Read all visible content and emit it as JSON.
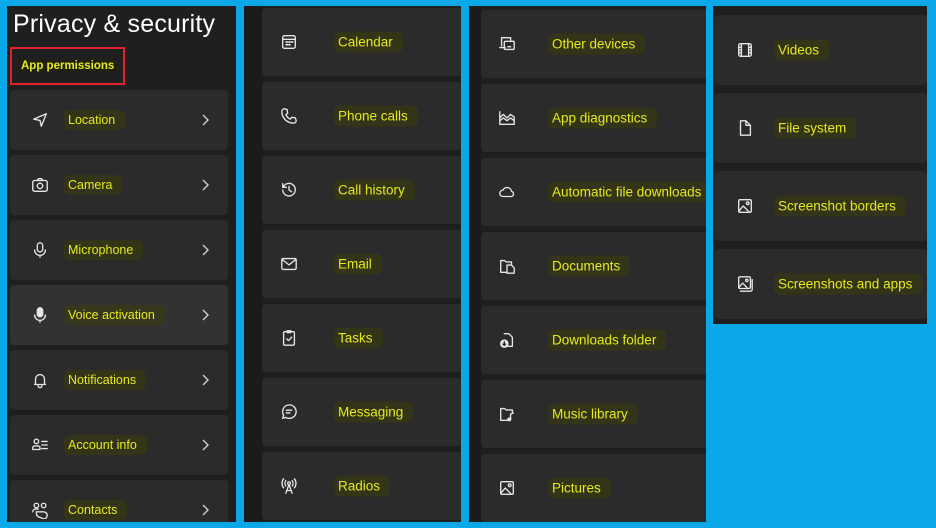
{
  "header": {
    "title": "Privacy & security",
    "section_label": "App permissions"
  },
  "colors": {
    "background": "#0aa8e6",
    "panel": "#1f1f1f",
    "card": "#2b2b2b",
    "highlight_text": "#e4ea1c",
    "section_box_border": "#e5202e"
  },
  "panels": [
    {
      "items": [
        {
          "label": "Location",
          "icon": "location-icon",
          "chevron": true
        },
        {
          "label": "Camera",
          "icon": "camera-icon",
          "chevron": true
        },
        {
          "label": "Microphone",
          "icon": "microphone-icon",
          "chevron": true
        },
        {
          "label": "Voice activation",
          "icon": "voice-activation-icon",
          "chevron": true
        },
        {
          "label": "Notifications",
          "icon": "bell-icon",
          "chevron": true
        },
        {
          "label": "Account info",
          "icon": "account-info-icon",
          "chevron": true
        },
        {
          "label": "Contacts",
          "icon": "contacts-icon",
          "chevron": true
        }
      ]
    },
    {
      "items": [
        {
          "label": "Calendar",
          "icon": "calendar-icon"
        },
        {
          "label": "Phone calls",
          "icon": "phone-icon"
        },
        {
          "label": "Call history",
          "icon": "history-icon"
        },
        {
          "label": "Email",
          "icon": "email-icon"
        },
        {
          "label": "Tasks",
          "icon": "tasks-icon"
        },
        {
          "label": "Messaging",
          "icon": "messaging-icon"
        },
        {
          "label": "Radios",
          "icon": "radio-tower-icon"
        }
      ]
    },
    {
      "items": [
        {
          "label": "Other devices",
          "icon": "other-devices-icon"
        },
        {
          "label": "App diagnostics",
          "icon": "app-diagnostics-icon"
        },
        {
          "label": "Automatic file downloads",
          "icon": "cloud-icon"
        },
        {
          "label": "Documents",
          "icon": "documents-icon"
        },
        {
          "label": "Downloads folder",
          "icon": "downloads-folder-icon"
        },
        {
          "label": "Music library",
          "icon": "music-library-icon"
        },
        {
          "label": "Pictures",
          "icon": "pictures-icon"
        }
      ]
    },
    {
      "items": [
        {
          "label": "Videos",
          "icon": "videos-icon"
        },
        {
          "label": "File system",
          "icon": "file-icon"
        },
        {
          "label": "Screenshot borders",
          "icon": "screenshot-borders-icon"
        },
        {
          "label": "Screenshots and apps",
          "icon": "screenshots-apps-icon"
        }
      ]
    }
  ]
}
